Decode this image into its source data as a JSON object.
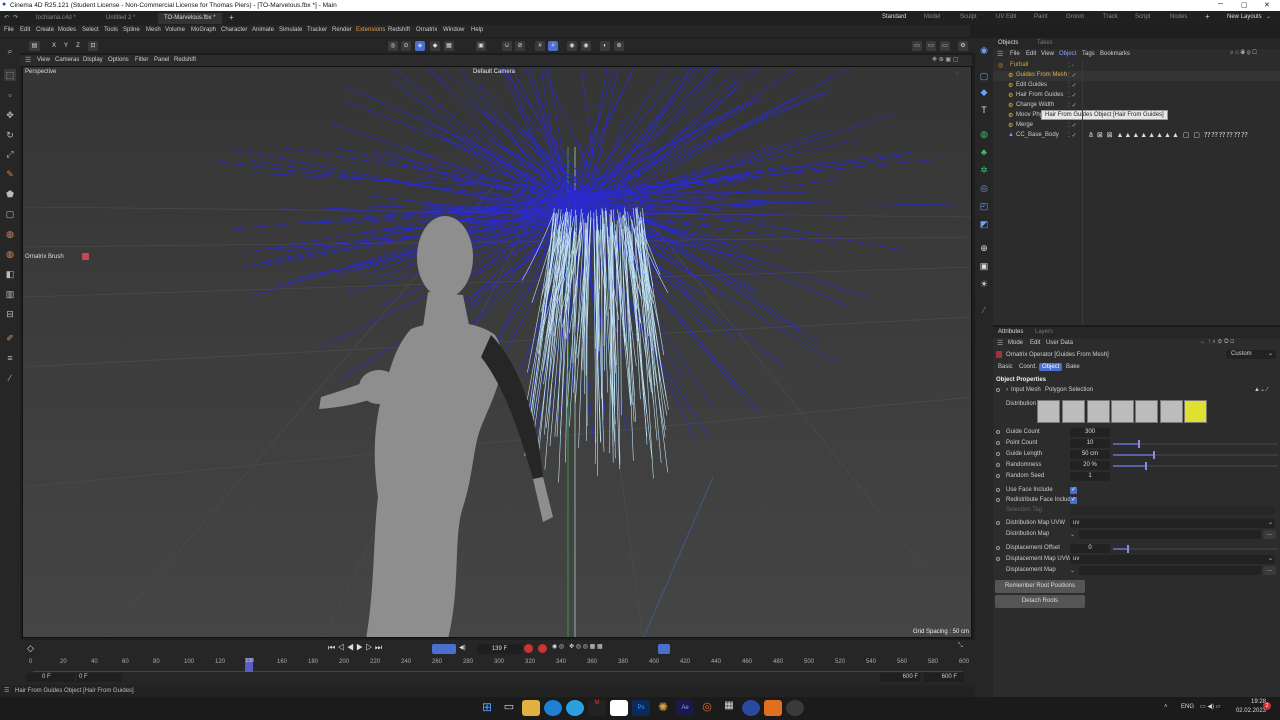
{
  "window": {
    "title": "Cinema 4D R25.121 (Student License - Non-Commercial License for Thomas Piers) - [TO-Marvelous.fbx *] - Main"
  },
  "doc_tabs": [
    "tochiama.c4d *",
    "Untitled 2 *",
    "TO-Marvelous.fbx *"
  ],
  "layouts": {
    "items": [
      "Standard",
      "Model",
      "Sculpt",
      "UV Edit",
      "Paint",
      "Groom",
      "Track",
      "Script",
      "Nodes"
    ],
    "new_layouts": "New Layouts"
  },
  "menu": [
    "File",
    "Edit",
    "Create",
    "Modes",
    "Select",
    "Tools",
    "Spline",
    "Mesh",
    "Volume",
    "MoGraph",
    "Character",
    "Animate",
    "Simulate",
    "Tracker",
    "Render",
    "Extensions",
    "Redshift",
    "Ornatrix",
    "Window",
    "Help"
  ],
  "viewport": {
    "menu": [
      "View",
      "Cameras",
      "Display",
      "Options",
      "Filter",
      "Panel",
      "Redshift"
    ],
    "label": "Perspective",
    "camera": "Default Camera",
    "hud_label": "Ornatrix Brush",
    "grid_spacing": "Grid Spacing : 50 cm"
  },
  "timeline": {
    "frame": "139 F",
    "ticks": [
      "0",
      "20",
      "40",
      "60",
      "80",
      "100",
      "120",
      "139",
      "160",
      "180",
      "200",
      "220",
      "240",
      "260",
      "280",
      "300",
      "320",
      "340",
      "360",
      "380",
      "400",
      "420",
      "440",
      "460",
      "480",
      "500",
      "520",
      "540",
      "560",
      "580",
      "600"
    ],
    "start": "0 F",
    "start2": "0 F",
    "end": "600 F",
    "end2": "600 F",
    "playhead_fraction": 0.2317
  },
  "status": {
    "text": "Hair From Guides Object [Hair From Guides]"
  },
  "objects": {
    "tabs": [
      "Objects",
      "Takes"
    ],
    "menu": [
      "File",
      "Edit",
      "View",
      "Object",
      "Tags",
      "Bookmarks"
    ],
    "items": [
      {
        "name": "Furball",
        "color": "#d0a040"
      },
      {
        "name": "Guides From Mesh",
        "color": "#e0b050"
      },
      {
        "name": "Edit Guides",
        "color": "#cccccc"
      },
      {
        "name": "Hair From Guides",
        "color": "#cccccc"
      },
      {
        "name": "Change Width",
        "color": "#cccccc"
      },
      {
        "name": "Moov Phy...",
        "color": "#cccccc"
      },
      {
        "name": "Merge",
        "color": "#cccccc"
      },
      {
        "name": "CC_Base_Body",
        "color": "#cccccc"
      }
    ],
    "tooltip": "Hair From Guides Object [Hair From Guides]"
  },
  "attributes": {
    "tabs": [
      "Attributes",
      "Layers"
    ],
    "menu": [
      "Mode",
      "Edit",
      "User Data"
    ],
    "preset": "Custom",
    "operator": "Ornatrix Operator [Guides From Mesh]",
    "subtabs": [
      "Basic",
      "Coord.",
      "Object",
      "Bake"
    ],
    "section": "Object Properties",
    "input_mesh_label": "Input Mesh",
    "input_mesh_value": "Polygon Selection",
    "distribution_label": "Distribution",
    "params": [
      {
        "label": "Guide Count",
        "value": "300",
        "fill": 0
      },
      {
        "label": "Point Count",
        "value": "10",
        "fill": 0.16
      },
      {
        "label": "Guide Length",
        "value": "50 cm",
        "fill": 0.25
      },
      {
        "label": "Randomness",
        "value": "20 %",
        "fill": 0.2
      },
      {
        "label": "Random Seed",
        "value": "1",
        "fill": 0
      }
    ],
    "use_face_include": "Use Face Include",
    "redistribute_face_include": "Redistribute Face Include",
    "selection_tag": "Selection Tag",
    "dist_map_uvw": "Distribution Map UVW",
    "dist_map_uvw_value": "uv",
    "dist_map": "Distribution Map",
    "disp_offset": "Displacement Offset",
    "disp_offset_value": "0",
    "disp_map_uvw": "Displacement Map UVW",
    "disp_map_uvw_value": "uv",
    "disp_map": "Displacement Map",
    "btn_remember": "Remember Root Positions",
    "btn_detach": "Detach Roots"
  },
  "tray": {
    "lang": "ENG",
    "time": "19:28",
    "date": "02.02.2023",
    "badge": "2"
  }
}
